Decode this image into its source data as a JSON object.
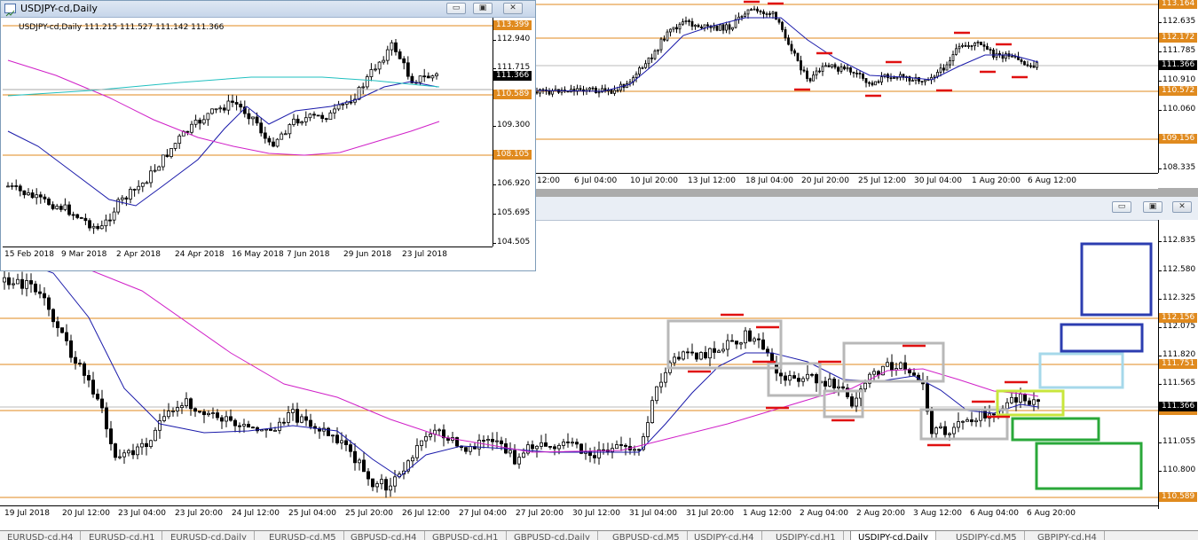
{
  "colors": {
    "level": "#e08a1e",
    "mark": "#e01010",
    "ma_blue": "#1a1aaa",
    "ma_magenta": "#d020c8",
    "ma_cyan": "#20c0c0",
    "box_gray": "#b8b8b8",
    "box_navy": "#2c3db0",
    "box_lightblue": "#a6d8ea",
    "box_lime": "#c8e63c",
    "box_green": "#2aa83a",
    "pricebox_bg": "#e08a1e",
    "current_bg": "#000000"
  },
  "daily_window": {
    "title": "USDJPY-cd,Daily",
    "info": "USDJPY-cd,Daily  111.215 111.527 111.142 111.366",
    "buttons": {
      "minimize": "▭",
      "restore": "▣",
      "close": "✕"
    },
    "price_ticks": [
      "112.940",
      "111.715",
      "109.300",
      "106.920",
      "105.695",
      "104.505"
    ],
    "level_labels": [
      "113.399",
      "110.589",
      "108.105"
    ],
    "current_price": "111.366",
    "x_labels": [
      "15 Feb 2018",
      "9 Mar 2018",
      "2 Apr 2018",
      "24 Apr 2018",
      "16 May 2018",
      "7 Jun 2018",
      "29 Jun 2018",
      "23 Jul 2018"
    ]
  },
  "h4_window": {
    "price_ticks": [
      "112.635",
      "111.785",
      "110.910",
      "110.060",
      "108.335"
    ],
    "level_labels": [
      "113.164",
      "112.172",
      "110.572",
      "109.156"
    ],
    "current_price": "111.366",
    "x_labels": [
      "12:00",
      "6 Jul 04:00",
      "10 Jul 20:00",
      "13 Jul 12:00",
      "18 Jul 04:00",
      "20 Jul 20:00",
      "25 Jul 12:00",
      "30 Jul 04:00",
      "1 Aug 20:00",
      "6 Aug 12:00"
    ]
  },
  "h1_window": {
    "buttons": {
      "minimize": "▭",
      "restore": "▣",
      "close": "✕"
    },
    "price_ticks": [
      "112.835",
      "112.580",
      "112.325",
      "112.075",
      "111.820",
      "111.565",
      "111.055",
      "110.800",
      "110.550"
    ],
    "level_labels": [
      "112.156",
      "111.751",
      "111.329",
      "110.589"
    ],
    "current_price": "111.366",
    "x_labels": [
      "19 Jul 2018",
      "20 Jul 12:00",
      "23 Jul 04:00",
      "23 Jul 20:00",
      "24 Jul 12:00",
      "25 Jul 04:00",
      "25 Jul 20:00",
      "26 Jul 12:00",
      "27 Jul 04:00",
      "27 Jul 20:00",
      "30 Jul 12:00",
      "31 Jul 04:00",
      "31 Jul 20:00",
      "1 Aug 12:00",
      "2 Aug 04:00",
      "2 Aug 20:00",
      "3 Aug 12:00",
      "6 Aug 04:00",
      "6 Aug 20:00"
    ]
  },
  "tabs": [
    "EURUSD-cd,H4",
    "EURUSD-cd,H1",
    "EURUSD-cd,Daily",
    "EURUSD-cd,M5",
    "GBPUSD-cd,H4",
    "GBPUSD-cd,H1",
    "GBPUSD-cd,Daily",
    "GBPUSD-cd,M5",
    "USDJPY-cd,H4",
    "USDJPY-cd,H1",
    "USDJPY-cd,Daily",
    "USDJPY-cd,M5",
    "GBPJPY-cd,H4"
  ],
  "active_tab": "USDJPY-cd,Daily"
}
